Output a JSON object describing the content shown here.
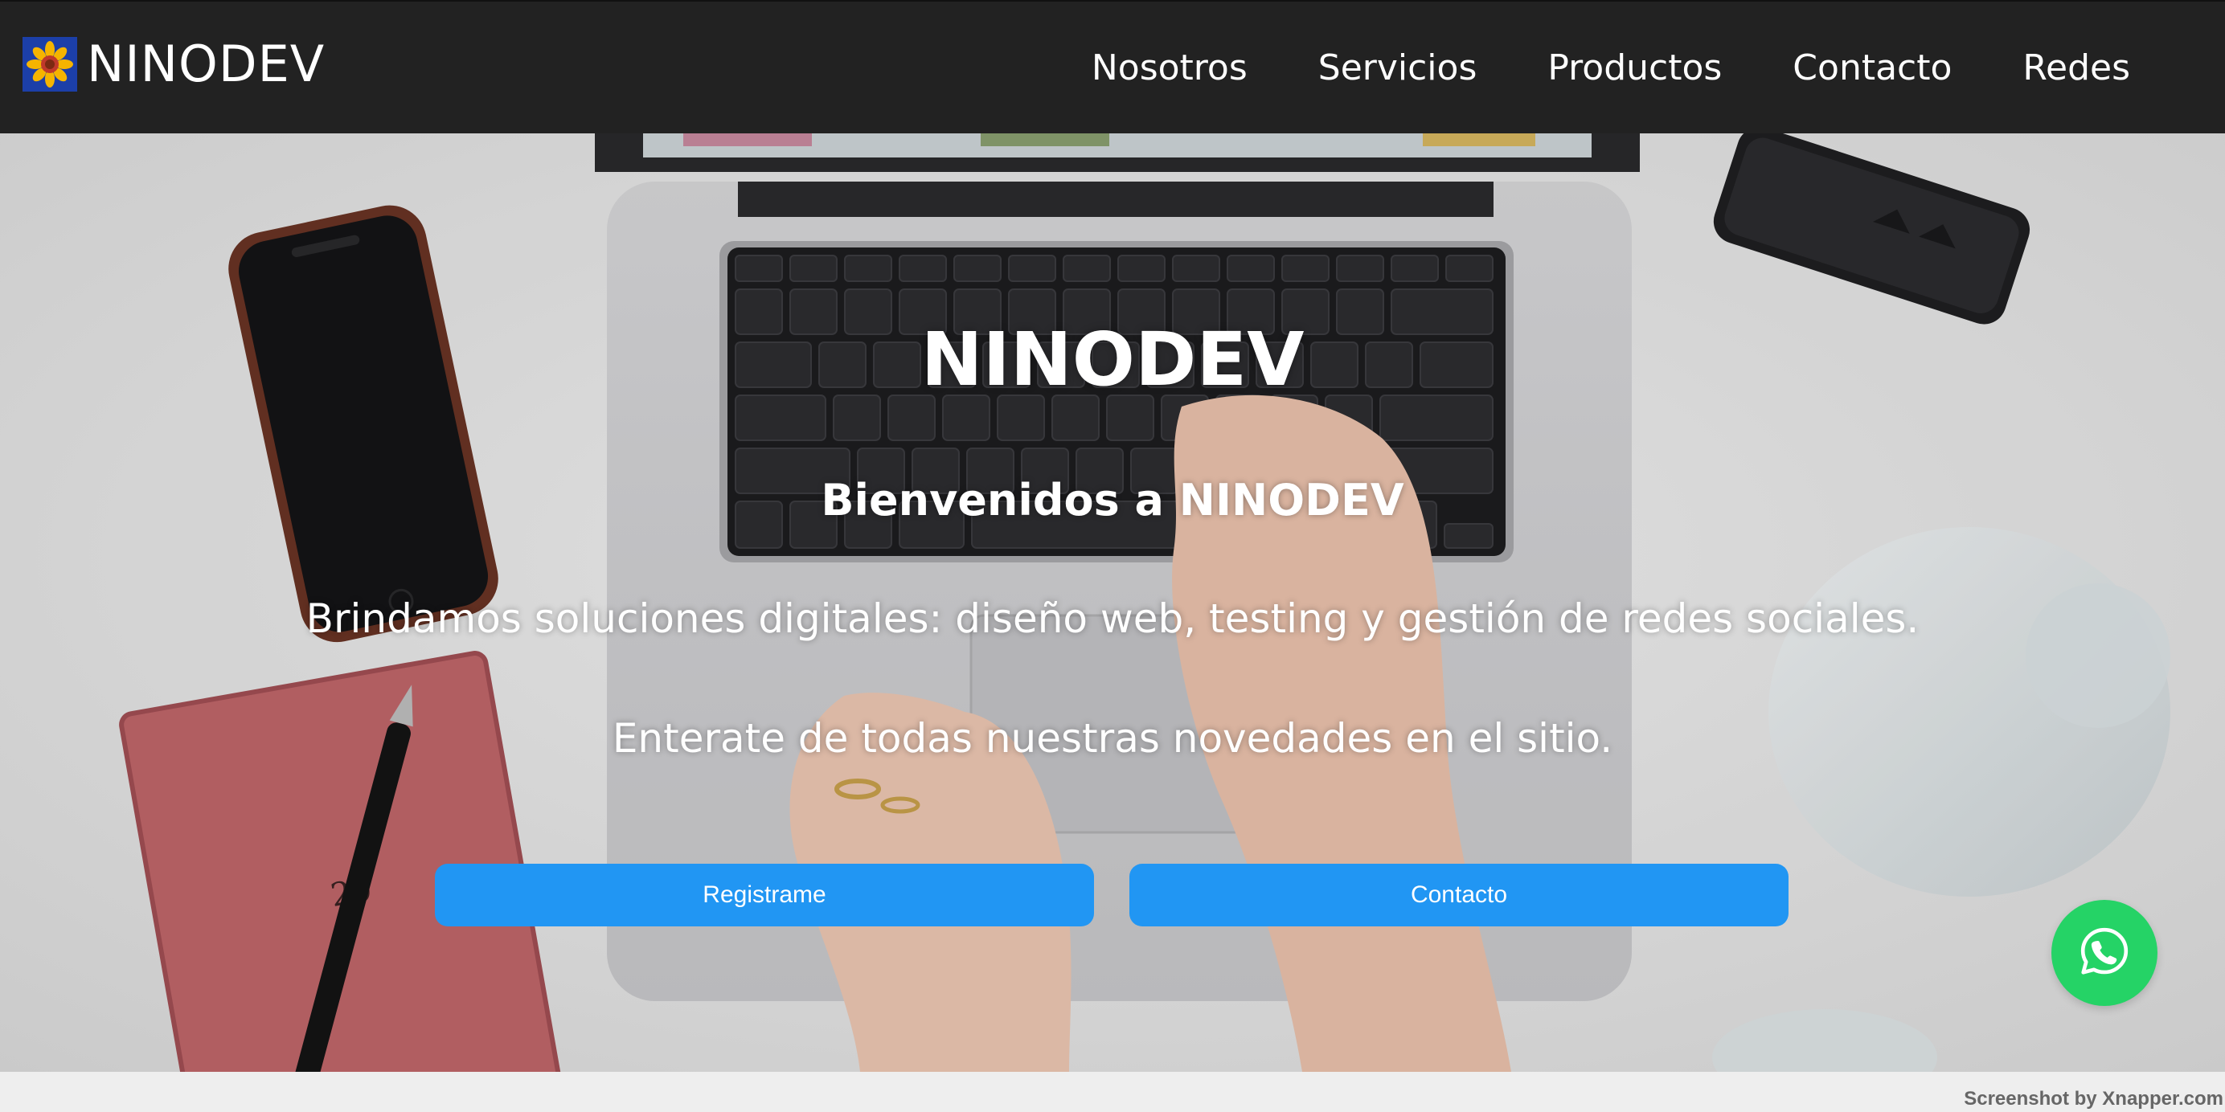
{
  "navbar": {
    "brand": "NINODEV",
    "links": [
      "Nosotros",
      "Servicios",
      "Productos",
      "Contacto",
      "Redes"
    ],
    "background": "#222222"
  },
  "hero": {
    "title": "NINODEV",
    "subtitle": "Bienvenidos a NINODEV",
    "text1": "Brindamos soluciones digitales: diseño web, testing y gestión de redes sociales.",
    "text2": "Enterate de todas nuestras novedades en el sitio.",
    "buttons": {
      "register": "Registrame",
      "contact": "Contacto"
    },
    "button_color": "#2196f3",
    "background_image": "desk-laptop-phone-notebook-icon"
  },
  "floating": {
    "whatsapp_icon": "whatsapp-icon",
    "color": "#25d366"
  },
  "watermark": "Screenshot by Xnapper.com"
}
